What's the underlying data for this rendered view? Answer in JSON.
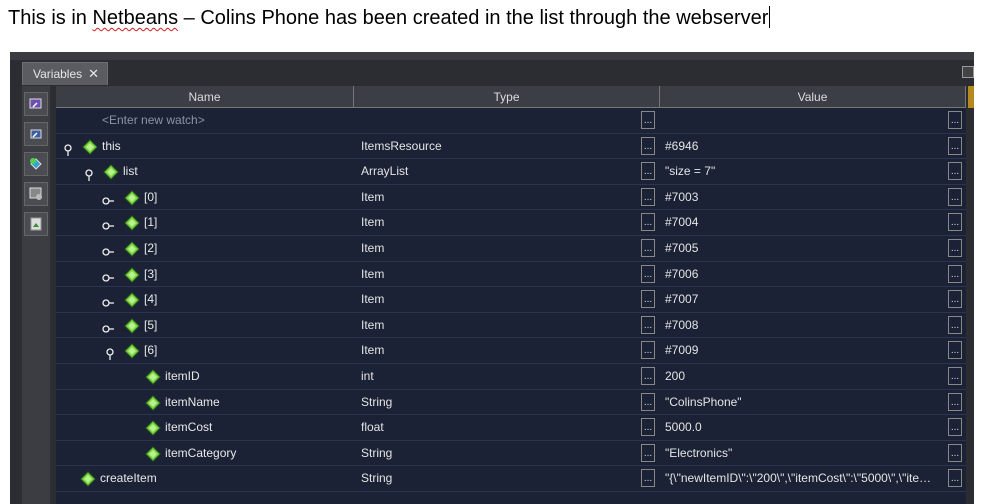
{
  "caption": {
    "before": "This is in ",
    "misspelled": "Netbeans",
    "after": " – Colins Phone has been created in the list through the webserver"
  },
  "panel": {
    "tab_label": "Variables",
    "close_glyph": "✕"
  },
  "columns": {
    "name": "Name",
    "type": "Type",
    "value": "Value"
  },
  "watch_placeholder": "<Enter new watch>",
  "dots": "...",
  "colors": {
    "value_text": "#e4e4e4",
    "diamond": "#7bd443",
    "table_bg": "#1b2235"
  },
  "rows": [
    {
      "name": "this",
      "type": "ItemsResource",
      "value": "#6946"
    },
    {
      "name": "list",
      "type": "ArrayList",
      "value": "\"size = 7\""
    },
    {
      "name": "[0]",
      "type": "Item",
      "value": "#7003"
    },
    {
      "name": "[1]",
      "type": "Item",
      "value": "#7004"
    },
    {
      "name": "[2]",
      "type": "Item",
      "value": "#7005"
    },
    {
      "name": "[3]",
      "type": "Item",
      "value": "#7006"
    },
    {
      "name": "[4]",
      "type": "Item",
      "value": "#7007"
    },
    {
      "name": "[5]",
      "type": "Item",
      "value": "#7008"
    },
    {
      "name": "[6]",
      "type": "Item",
      "value": "#7009"
    },
    {
      "name": "itemID",
      "type": "int",
      "value": "200"
    },
    {
      "name": "itemName",
      "type": "String",
      "value": "\"ColinsPhone\""
    },
    {
      "name": "itemCost",
      "type": "float",
      "value": "5000.0"
    },
    {
      "name": "itemCategory",
      "type": "String",
      "value": "\"Electronics\""
    },
    {
      "name": "createItem",
      "type": "String",
      "value": "\"{\\\"newItemID\\\":\\\"200\\\",\\\"itemCost\\\":\\\"5000\\\",\\\"ite…"
    }
  ]
}
